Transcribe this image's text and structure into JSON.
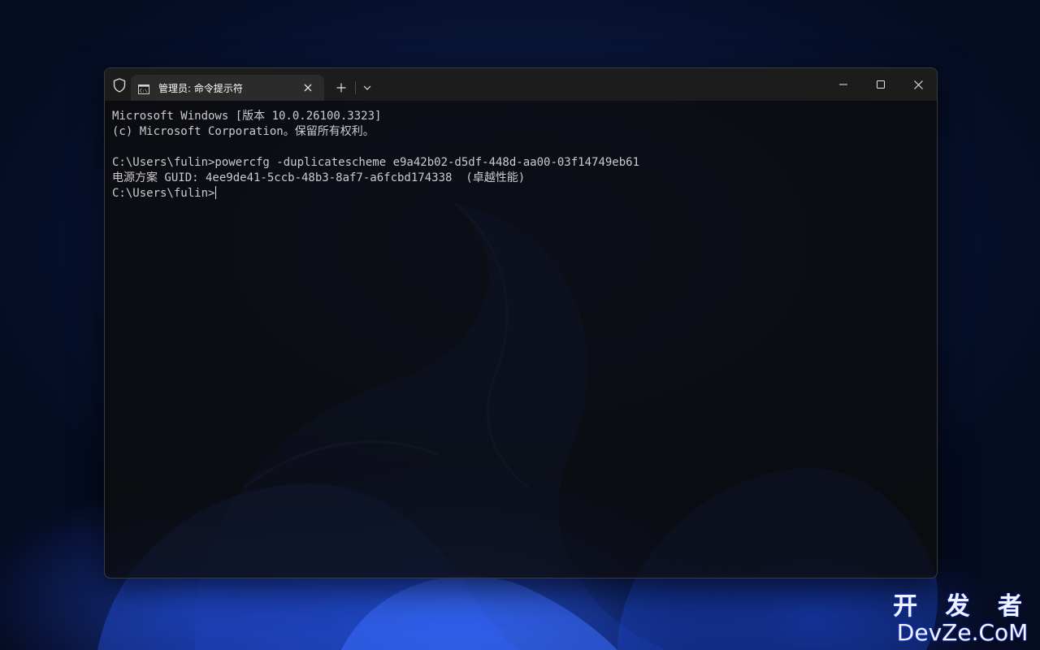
{
  "window": {
    "tab_title": "管理员: 命令提示符",
    "icons": {
      "shield": "shield-icon",
      "tab": "cmd-icon",
      "tab_close": "close-icon",
      "new_tab": "plus-icon",
      "dropdown": "chevron-down-icon",
      "minimize": "minimize-icon",
      "maximize": "maximize-icon",
      "close": "close-icon"
    }
  },
  "console": {
    "lines": [
      "Microsoft Windows [版本 10.0.26100.3323]",
      "(c) Microsoft Corporation。保留所有权利。",
      "",
      "C:\\Users\\fulin>powercfg -duplicatescheme e9a42b02-d5df-448d-aa00-03f14749eb61",
      "电源方案 GUID: 4ee9de41-5ccb-48b3-8af7-a6fcbd174338  (卓越性能)",
      "C:\\Users\\fulin>"
    ]
  },
  "watermark": {
    "top": "开 发 者",
    "bottom": "DevZe.CoM"
  },
  "colors": {
    "terminal_text": "#cccccc",
    "titlebar": "#1c1c1c",
    "active_tab": "#2b2b2b",
    "desktop_accent": "#2a5ae6"
  }
}
